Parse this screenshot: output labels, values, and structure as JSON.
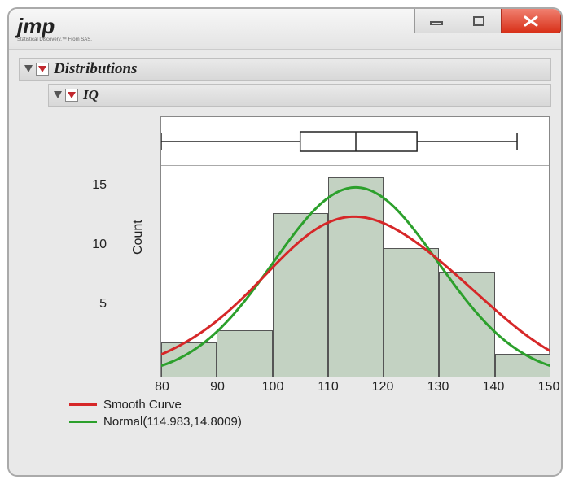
{
  "app": {
    "logo_text": "jmp",
    "logo_tagline": "Statistical Discovery.™ From SAS."
  },
  "outline": {
    "distributions_label": "Distributions",
    "variable_label": "IQ"
  },
  "axes": {
    "ylabel": "Count",
    "yticks": [
      "5",
      "10",
      "15"
    ],
    "xticks": [
      "80",
      "90",
      "100",
      "110",
      "120",
      "130",
      "140",
      "150"
    ]
  },
  "legend": {
    "smooth_label": "Smooth Curve",
    "normal_label": "Normal(114.983,14.8009)",
    "smooth_color": "#d62728",
    "normal_color": "#2ca02c"
  },
  "chart_data": {
    "type": "bar",
    "title": "",
    "xlabel": "",
    "ylabel": "Count",
    "xlim": [
      80,
      150
    ],
    "ylim": [
      0,
      18
    ],
    "bin_width": 10,
    "bin_edges": [
      80,
      90,
      100,
      110,
      120,
      130,
      140,
      150
    ],
    "categories": [
      "80–90",
      "90–100",
      "100–110",
      "110–120",
      "120–130",
      "130–140",
      "140–150"
    ],
    "values": [
      3,
      4,
      14,
      17,
      11,
      9,
      2
    ],
    "overlays": [
      {
        "name": "Smooth Curve",
        "type": "line",
        "color": "#d62728"
      },
      {
        "name": "Normal(114.983,14.8009)",
        "type": "line",
        "color": "#2ca02c",
        "params": {
          "mean": 114.983,
          "sd": 14.8009
        }
      }
    ],
    "boxplot": {
      "min": 80,
      "q1": 105,
      "median": 115,
      "q3": 126,
      "max": 144
    }
  }
}
